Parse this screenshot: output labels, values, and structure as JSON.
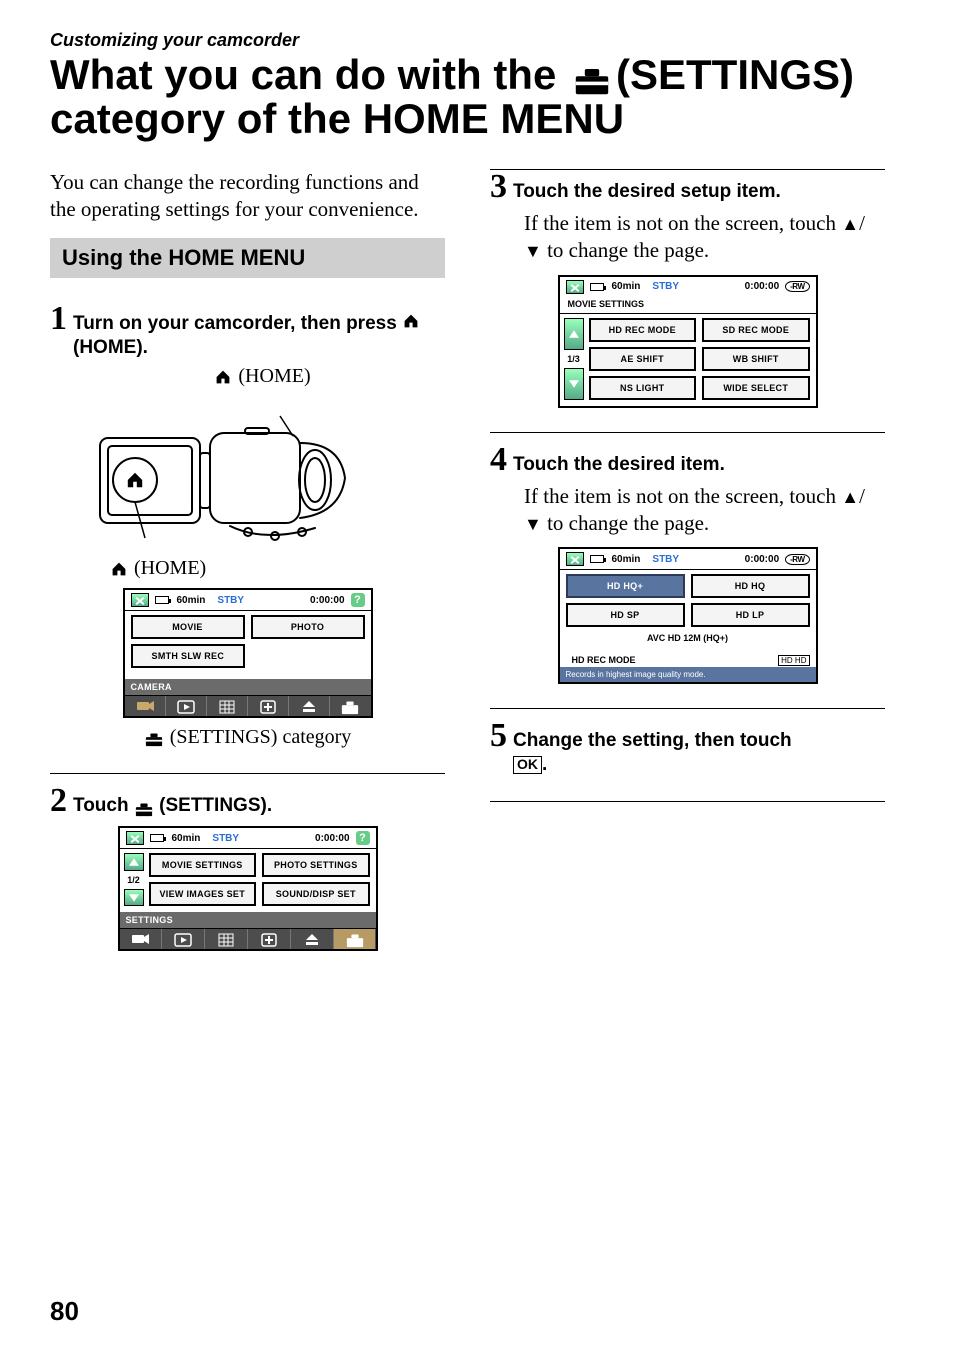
{
  "kicker": "Customizing your camcorder",
  "title_line1_a": "What you can do with the",
  "title_line1_b": "(SETTINGS)",
  "title_line2": "category of the HOME MENU",
  "intro": "You can change the recording functions and the operating settings for your convenience.",
  "subhead": "Using the HOME MENU",
  "steps": {
    "1": {
      "num": "1",
      "head_a": "Turn on your camcorder, then press",
      "head_b": "(HOME).",
      "label_home": "(HOME)",
      "label_settings_cat": "(SETTINGS) category"
    },
    "2": {
      "num": "2",
      "head_a": "Touch",
      "head_b": "(SETTINGS)."
    },
    "3": {
      "num": "3",
      "head": "Touch the desired setup item.",
      "body_a": "If the item is not on the screen, touch",
      "body_b": "to change the page."
    },
    "4": {
      "num": "4",
      "head": "Touch the desired item.",
      "body_a": "If the item is not on the screen, touch",
      "body_b": "to change the page."
    },
    "5": {
      "num": "5",
      "head_a": "Change the setting, then touch",
      "head_b": ".",
      "ok": "OK"
    }
  },
  "screen1": {
    "batt": "60min",
    "status": "STBY",
    "time": "0:00:00",
    "btn1": "MOVIE",
    "btn2": "PHOTO",
    "btn3": "SMTH SLW REC",
    "cat": "CAMERA"
  },
  "screen2": {
    "batt": "60min",
    "status": "STBY",
    "time": "0:00:00",
    "page": "1/2",
    "b1": "MOVIE SETTINGS",
    "b2": "PHOTO SETTINGS",
    "b3": "VIEW IMAGES SET",
    "b4": "SOUND/DISP SET",
    "cat": "SETTINGS"
  },
  "screen3": {
    "batt": "60min",
    "status": "STBY",
    "time": "0:00:00",
    "disc": "-RW",
    "sub": "MOVIE SETTINGS",
    "page": "1/3",
    "b1": "HD REC MODE",
    "b2": "SD REC MODE",
    "b3": "AE SHIFT",
    "b4": "WB SHIFT",
    "b5": "NS LIGHT",
    "b6": "WIDE SELECT"
  },
  "screen4": {
    "batt": "60min",
    "status": "STBY",
    "time": "0:00:00",
    "disc": "-RW",
    "b1": "HD HQ+",
    "b2": "HD HQ",
    "b3": "HD SP",
    "b4": "HD LP",
    "single": "AVC HD 12M (HQ+)",
    "rec": "HD REC MODE",
    "hdhd": "HD HD",
    "foot": "Records in highest image quality mode."
  },
  "page_number": "80"
}
